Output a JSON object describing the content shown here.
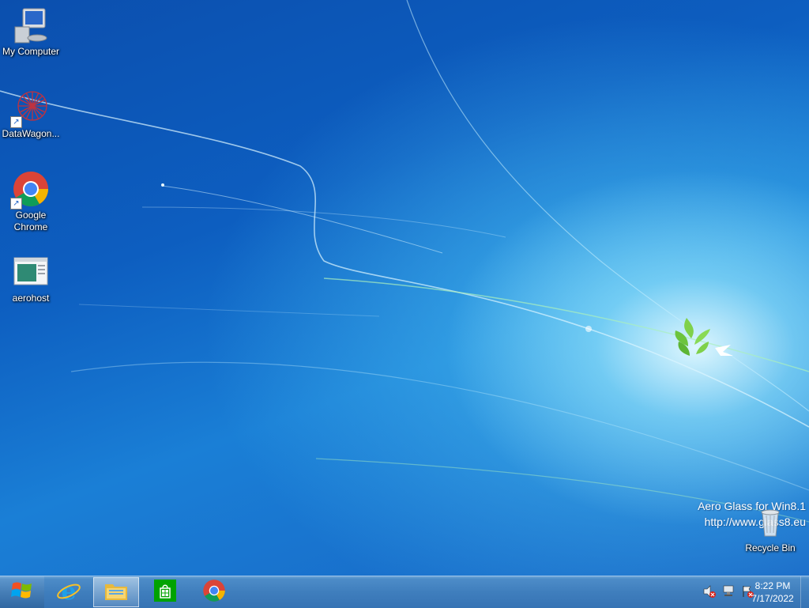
{
  "desktop": {
    "icons": [
      {
        "label": "My Computer",
        "icon": "computer-icon"
      },
      {
        "label": "DataWagon...",
        "icon": "datawagon-icon"
      },
      {
        "label": "Google Chrome",
        "icon": "chrome-icon"
      },
      {
        "label": "aerohost",
        "icon": "aerohost-icon"
      }
    ],
    "recycle_bin": {
      "label": "Recycle Bin",
      "icon": "recycle-bin-icon"
    },
    "watermark": {
      "line1": "Aero Glass for Win8.1",
      "line2": "http://www.glass8.eu"
    }
  },
  "taskbar": {
    "start": {
      "icon": "windows-logo-icon"
    },
    "pinned": [
      {
        "name": "Internet Explorer",
        "icon": "internet-explorer-icon"
      },
      {
        "name": "File Explorer",
        "icon": "file-explorer-icon",
        "active": true
      },
      {
        "name": "Store",
        "icon": "store-icon"
      },
      {
        "name": "Google Chrome",
        "icon": "chrome-icon"
      }
    ],
    "tray": {
      "icons": [
        "volume-muted-icon",
        "network-icon",
        "action-center-flag-icon"
      ],
      "time": "8:22 PM",
      "date": "7/17/2022"
    }
  },
  "colors": {
    "taskbar": "#3f7ebd",
    "desktop_dark": "#0b4fae",
    "desktop_light": "#5cc3f0"
  }
}
